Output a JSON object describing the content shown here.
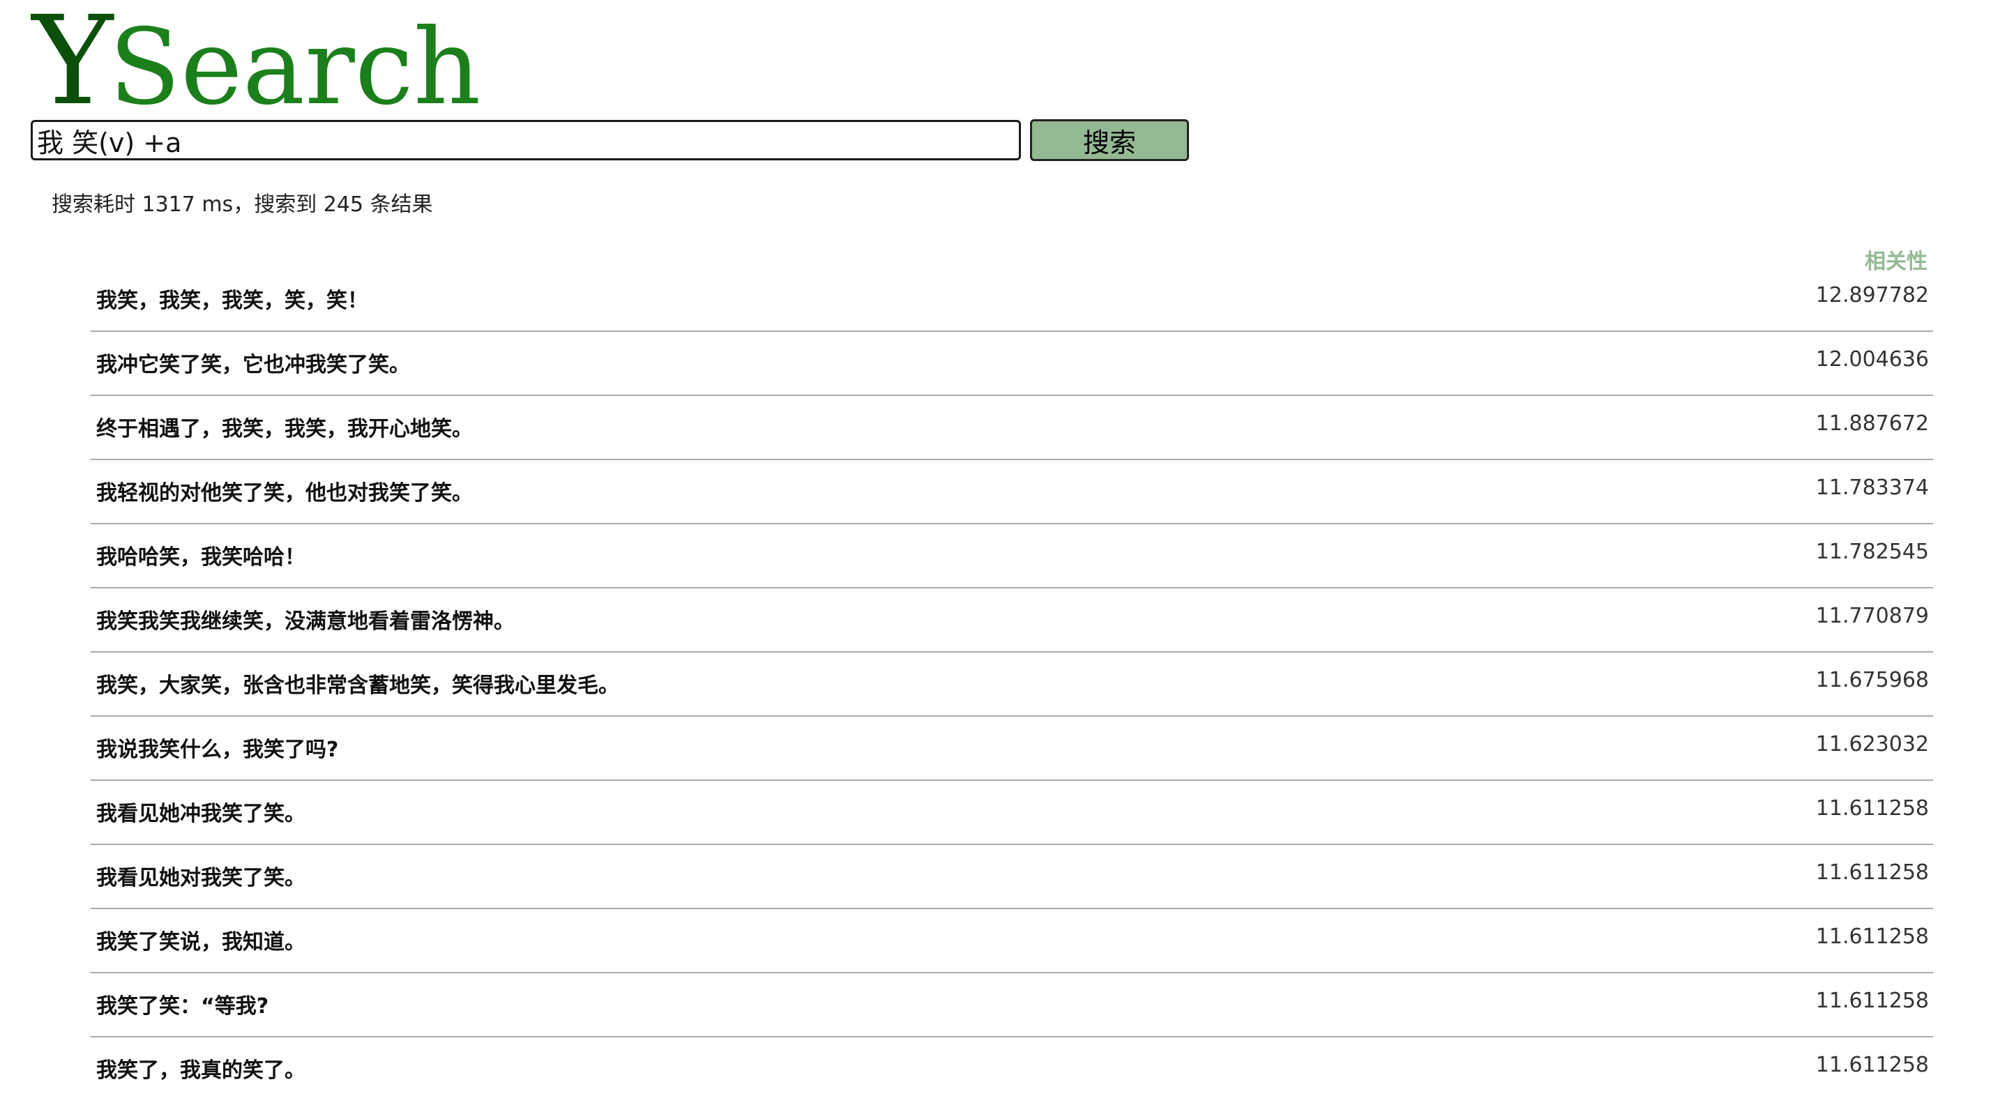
{
  "logo": {
    "first_letter": "Y",
    "rest": "Search",
    "colors": {
      "first_letter": "#0b4f0b",
      "rest": "#1b7f1b"
    }
  },
  "search": {
    "query": "我 笑(v) +a",
    "button_label": "搜索",
    "button_color": "#93b993"
  },
  "stats": {
    "text": "搜索耗时 1317 ms，搜索到 245 条结果"
  },
  "results": {
    "relevance_header": "相关性",
    "header_color": "#93b993",
    "items": [
      {
        "text": "我笑，我笑，我笑，笑，笑！",
        "score": "12.897782"
      },
      {
        "text": "我冲它笑了笑，它也冲我笑了笑。",
        "score": "12.004636"
      },
      {
        "text": "终于相遇了，我笑，我笑，我开心地笑。",
        "score": "11.887672"
      },
      {
        "text": "我轻视的对他笑了笑，他也对我笑了笑。",
        "score": "11.783374"
      },
      {
        "text": "我哈哈笑，我笑哈哈！",
        "score": "11.782545"
      },
      {
        "text": "我笑我笑我继续笑，没满意地看着雷洛愣神。",
        "score": "11.770879"
      },
      {
        "text": "我笑，大家笑，张含也非常含蓄地笑，笑得我心里发毛。",
        "score": "11.675968"
      },
      {
        "text": "我说我笑什么，我笑了吗?",
        "score": "11.623032"
      },
      {
        "text": "我看见她冲我笑了笑。",
        "score": "11.611258"
      },
      {
        "text": "我看见她对我笑了笑。",
        "score": "11.611258"
      },
      {
        "text": "我笑了笑说，我知道。",
        "score": "11.611258"
      },
      {
        "text": "我笑了笑：“等我?",
        "score": "11.611258"
      },
      {
        "text": "我笑了，我真的笑了。",
        "score": "11.611258"
      }
    ]
  }
}
